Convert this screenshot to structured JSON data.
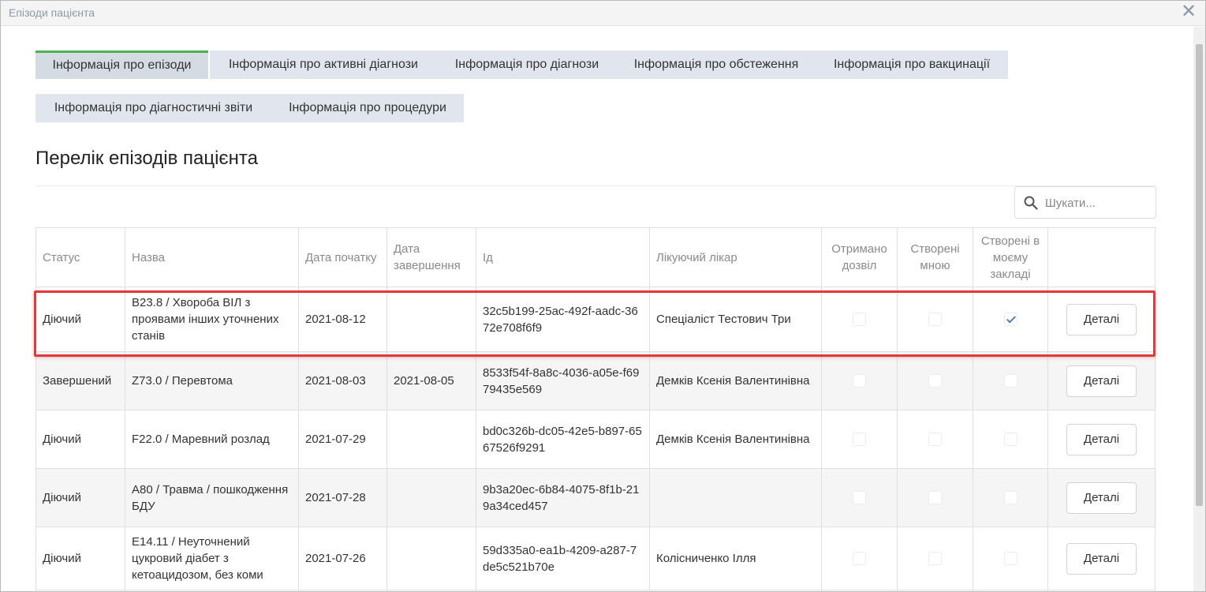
{
  "window": {
    "title": "Епізоди пацієнта"
  },
  "tabs": [
    {
      "label": "Інформація про епізоди",
      "active": true
    },
    {
      "label": "Інформація про активні діагнози",
      "active": false
    },
    {
      "label": "Інформація про діагнози",
      "active": false
    },
    {
      "label": "Інформація про обстеження",
      "active": false
    },
    {
      "label": "Інформація про вакцинації",
      "active": false
    },
    {
      "label": "Інформація про діагностичні звіти",
      "active": false
    },
    {
      "label": "Інформація про процедури",
      "active": false
    }
  ],
  "page": {
    "heading": "Перелік епізодів пацієнта"
  },
  "search": {
    "placeholder": "Шукати...",
    "value": ""
  },
  "table": {
    "headers": {
      "status": "Статус",
      "name": "Назва",
      "start_date": "Дата початку",
      "end_date": "Дата завершення",
      "id": "Ід",
      "doctor": "Лікуючий лікар",
      "permission": "Отримано дозвіл",
      "created_by_me": "Створені мною",
      "created_in_facility": "Створені в моєму закладі"
    },
    "details_label": "Деталі",
    "rows": [
      {
        "status": "Діючий",
        "name": "B23.8 / Хвороба ВІЛ з проявами інших уточнених станів",
        "start_date": "2021-08-12",
        "end_date": "",
        "id": "32c5b199-25ac-492f-aadc-3672e708f6f9",
        "doctor": "Спеціаліст Тестович Три",
        "permission": false,
        "created_by_me": false,
        "created_in_facility": true,
        "highlighted": true
      },
      {
        "status": "Завершений",
        "name": "Z73.0 / Перевтома",
        "start_date": "2021-08-03",
        "end_date": "2021-08-05",
        "id": "8533f54f-8a8c-4036-a05e-f6979435e569",
        "doctor": "Демків Ксенія Валентинівна",
        "permission": false,
        "created_by_me": false,
        "created_in_facility": false,
        "highlighted": false
      },
      {
        "status": "Діючий",
        "name": "F22.0 / Маревний розлад",
        "start_date": "2021-07-29",
        "end_date": "",
        "id": "bd0c326b-dc05-42e5-b897-6567526f9291",
        "doctor": "Демків Ксенія Валентинівна",
        "permission": false,
        "created_by_me": false,
        "created_in_facility": false,
        "highlighted": false
      },
      {
        "status": "Діючий",
        "name": "A80 / Травма / пошкодження БДУ",
        "start_date": "2021-07-28",
        "end_date": "",
        "id": "9b3a20ec-6b84-4075-8f1b-219a34ced457",
        "doctor": "",
        "permission": false,
        "created_by_me": false,
        "created_in_facility": false,
        "highlighted": false
      },
      {
        "status": "Діючий",
        "name": "E14.11 / Неуточнений цукровий діабет з кетоацидозом, без коми",
        "start_date": "2021-07-26",
        "end_date": "",
        "id": "59d335a0-ea1b-4209-a287-7de5c521b70e",
        "doctor": "Колісниченко Ілля",
        "permission": false,
        "created_by_me": false,
        "created_in_facility": false,
        "highlighted": false
      }
    ]
  }
}
